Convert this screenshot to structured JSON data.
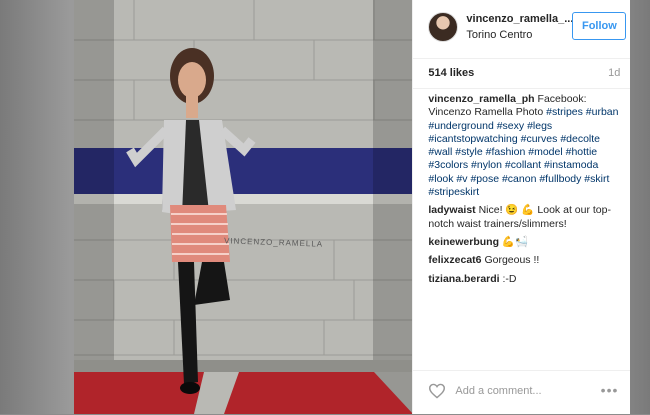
{
  "post": {
    "username": "vincenzo_ramella_...",
    "location": "Torino Centro",
    "follow_label": "Follow",
    "likes": "514 likes",
    "age": "1d",
    "wall_text": "VINCENZO_RAMELLA"
  },
  "caption": {
    "user": "vincenzo_ramella_ph",
    "text": "Facebook: Vincenzo Ramella Photo",
    "tags": [
      "#stripes",
      "#urban",
      "#underground",
      "#sexy",
      "#legs",
      "#icantstopwatching",
      "#curves",
      "#decolte",
      "#wall",
      "#style",
      "#fashion",
      "#model",
      "#hottie",
      "#3colors",
      "#nylon",
      "#collant",
      "#instamoda",
      "#look",
      "#v",
      "#pose",
      "#canon",
      "#fullbody",
      "#skirt",
      "#stripeskirt"
    ]
  },
  "comments": [
    {
      "user": "ladywaist",
      "text": "Nice! 😉 💪 Look at our top-notch waist trainers/slimmers!"
    },
    {
      "user": "keinewerbung",
      "text": "💪🛀"
    },
    {
      "user": "felixzecat6",
      "text": "Gorgeous !!"
    },
    {
      "user": "tiziana.berardi",
      "text": ":-D"
    }
  ],
  "footer": {
    "add_comment_placeholder": "Add a comment...",
    "more_icon": "more-options-icon"
  },
  "icons": {
    "heart": "heart-icon",
    "avatar": "avatar"
  }
}
